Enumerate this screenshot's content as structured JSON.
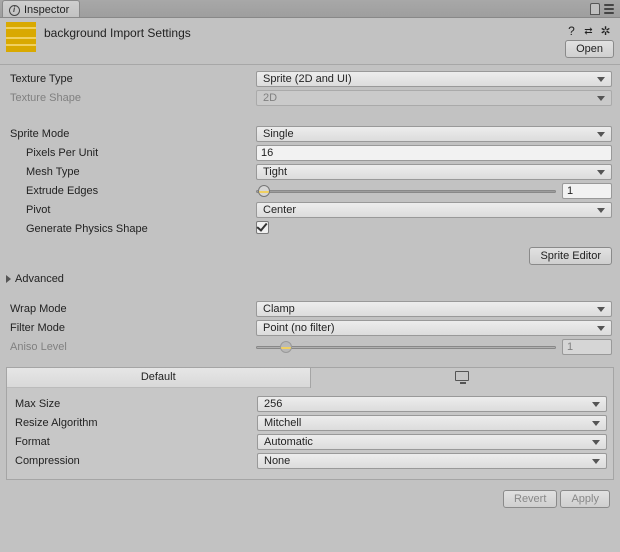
{
  "tab": {
    "label": "Inspector"
  },
  "header": {
    "title": "background Import Settings",
    "open": "Open"
  },
  "labels": {
    "texture_type": "Texture Type",
    "texture_shape": "Texture Shape",
    "sprite_mode": "Sprite Mode",
    "pixels_per_unit": "Pixels Per Unit",
    "mesh_type": "Mesh Type",
    "extrude_edges": "Extrude Edges",
    "pivot": "Pivot",
    "generate_physics": "Generate Physics Shape",
    "sprite_editor_btn": "Sprite Editor",
    "advanced": "Advanced",
    "wrap_mode": "Wrap Mode",
    "filter_mode": "Filter Mode",
    "aniso_level": "Aniso Level",
    "default_tab": "Default",
    "max_size": "Max Size",
    "resize_algo": "Resize Algorithm",
    "format": "Format",
    "compression": "Compression",
    "revert": "Revert",
    "apply": "Apply"
  },
  "values": {
    "texture_type": "Sprite (2D and UI)",
    "texture_shape": "2D",
    "sprite_mode": "Single",
    "pixels_per_unit": "16",
    "mesh_type": "Tight",
    "extrude_edges": "1",
    "pivot": "Center",
    "generate_physics": true,
    "wrap_mode": "Clamp",
    "filter_mode": "Point (no filter)",
    "aniso_level": "1",
    "max_size": "256",
    "resize_algo": "Mitchell",
    "format": "Automatic",
    "compression": "None"
  }
}
